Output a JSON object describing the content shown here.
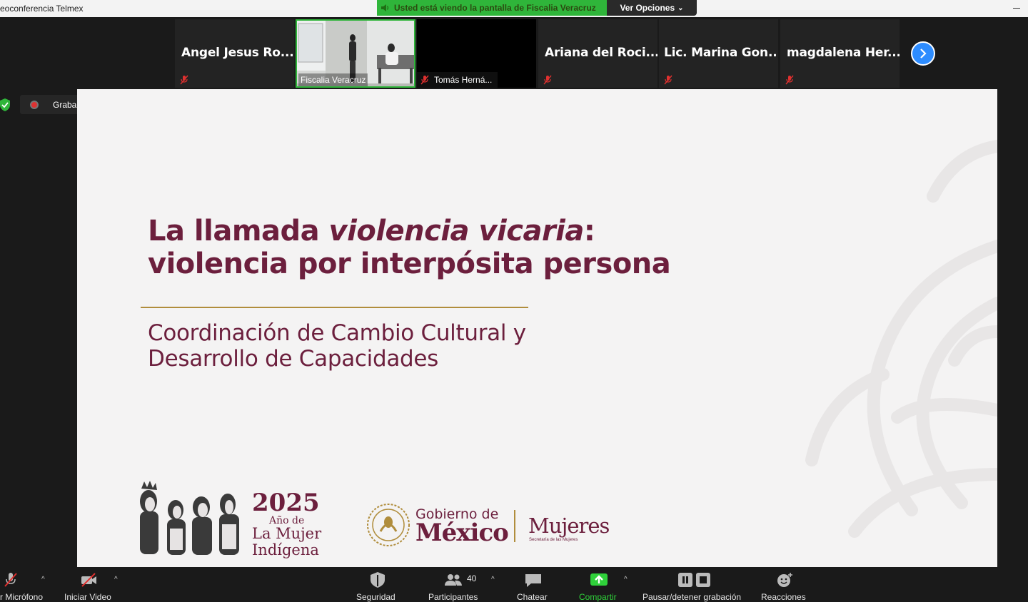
{
  "window": {
    "title": "eoconferencia Telmex"
  },
  "share_banner": {
    "message": "Usted está viendo la pantalla de Fiscalia Veracruz",
    "options_label": "Ver Opciones",
    "color": "#2fb53a"
  },
  "gallery": {
    "participants": [
      {
        "name": "Angel Jesus Ro...",
        "muted": true
      },
      {
        "name": "Fiscalia Veracruz",
        "video": true
      },
      {
        "name": "Tomás Herná...",
        "muted": true
      },
      {
        "name": "Ariana del Roci...",
        "muted": true
      },
      {
        "name": "Lic. Marina Gon...",
        "muted": true
      },
      {
        "name": "magdalena Her...",
        "muted": true
      }
    ],
    "next_icon": "chevron-right-icon"
  },
  "recording": {
    "label": "Grabando..."
  },
  "slide": {
    "title_part1": "La llamada ",
    "title_italic": "violencia vicaria",
    "title_part2": ":",
    "title_line2": "violencia por interpósita persona",
    "subtitle_line1": "Coordinación de Cambio Cultural y",
    "subtitle_line2": "Desarrollo de Capacidades",
    "year_logo": {
      "year": "2025",
      "ano_de": "Año de",
      "line1": "La Mujer",
      "line2": "Indígena"
    },
    "gobierno": {
      "line1": "Gobierno de",
      "line2": "México"
    },
    "mujeres": {
      "name": "Mujeres",
      "sub": "Secretaría de las Mujeres"
    },
    "brand_color": "#6c1f3d",
    "accent_color": "#b08d3c"
  },
  "toolbar": {
    "microphone": "r Micrófono",
    "video": "Iniciar Video",
    "security": "Seguridad",
    "participants": "Participantes",
    "participants_count": "40",
    "chat": "Chatear",
    "share": "Compartir",
    "recording": "Pausar/detener grabación",
    "reactions": "Reacciones"
  }
}
